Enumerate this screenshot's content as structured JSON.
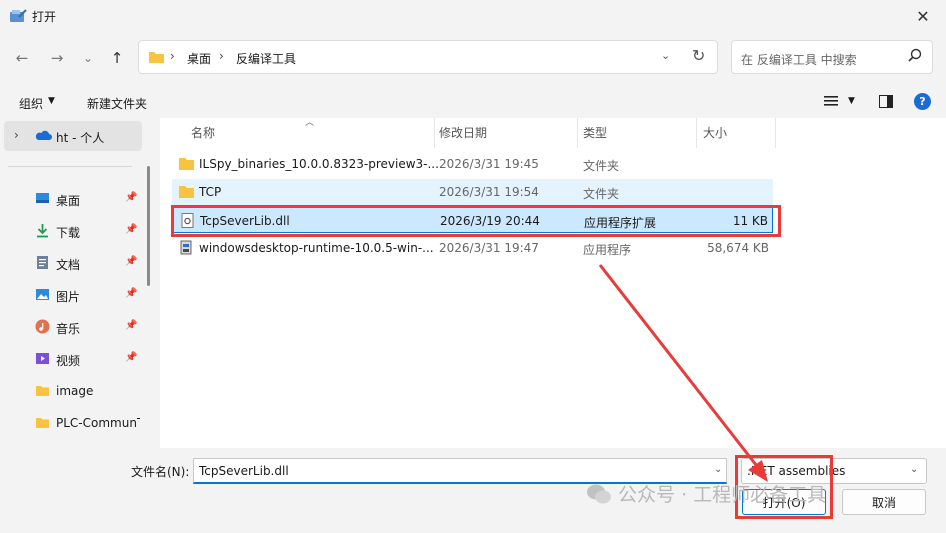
{
  "window": {
    "title": "打开",
    "close_glyph": "✕"
  },
  "nav": {
    "back": "←",
    "forward": "→",
    "recent": "⌄",
    "up": "↑",
    "refresh": "↻",
    "dropdown": "⌄"
  },
  "breadcrumb": {
    "items": [
      "桌面",
      "反编译工具"
    ],
    "sep": "›"
  },
  "search": {
    "placeholder": "在 反编译工具 中搜索"
  },
  "toolbar": {
    "organize": "组织",
    "new_folder": "新建文件夹",
    "help": "?"
  },
  "sidebar": {
    "cloud_label": "ht - 个人",
    "items": [
      {
        "label": "桌面",
        "icon": "desktop-icon",
        "pinned": true
      },
      {
        "label": "下载",
        "icon": "download-icon",
        "pinned": true
      },
      {
        "label": "文档",
        "icon": "document-icon",
        "pinned": true
      },
      {
        "label": "图片",
        "icon": "picture-icon",
        "pinned": true
      },
      {
        "label": "音乐",
        "icon": "music-icon",
        "pinned": true
      },
      {
        "label": "视频",
        "icon": "video-icon",
        "pinned": true
      },
      {
        "label": "image",
        "icon": "folder-icon",
        "pinned": false
      },
      {
        "label": "PLC-CommunT",
        "icon": "folder-icon",
        "pinned": false
      }
    ]
  },
  "columns": {
    "name": "名称",
    "date": "修改日期",
    "type": "类型",
    "size": "大小"
  },
  "files": [
    {
      "name": "ILSpy_binaries_10.0.0.8323-preview3-...",
      "date": "2026/3/31 19:45",
      "type": "文件夹",
      "size": "",
      "icon": "folder-icon"
    },
    {
      "name": "TCP",
      "date": "2026/3/31 19:54",
      "type": "文件夹",
      "size": "",
      "icon": "folder-icon"
    },
    {
      "name": "TcpSeverLib.dll",
      "date": "2026/3/19 20:44",
      "type": "应用程序扩展",
      "size": "11 KB",
      "icon": "dll-icon"
    },
    {
      "name": "windowsdesktop-runtime-10.0.5-win-...",
      "date": "2026/3/31 19:47",
      "type": "应用程序",
      "size": "58,674 KB",
      "icon": "installer-icon"
    }
  ],
  "bottom": {
    "filename_label": "文件名(N):",
    "filename_value": "TcpSeverLib.dll",
    "filetype_value": ".NET assemblies",
    "open_label": "打开(O)",
    "cancel_label": "取消"
  },
  "watermark": "公众号 · 工程师必备工具",
  "colors": {
    "accent": "#0078d4",
    "annotation": "#ea3b3b",
    "folder": "#f8c440"
  }
}
